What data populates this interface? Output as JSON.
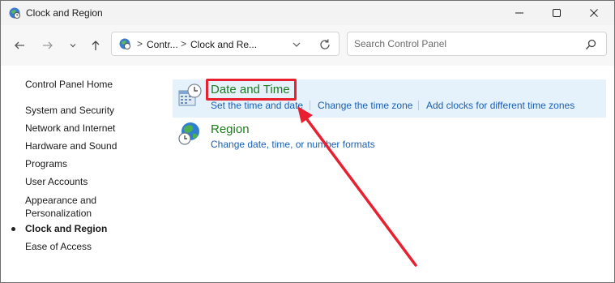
{
  "window": {
    "title": "Clock and Region"
  },
  "title_buttons": {
    "minimize": "—",
    "maximize": "☐",
    "close": "✕"
  },
  "address": {
    "breadcrumbs": [
      "Contr...",
      "Clock and Re..."
    ],
    "separator": ">"
  },
  "search": {
    "placeholder": "Search Control Panel"
  },
  "sidebar": {
    "home": "Control Panel Home",
    "items": [
      {
        "label": "System and Security",
        "active": false
      },
      {
        "label": "Network and Internet",
        "active": false
      },
      {
        "label": "Hardware and Sound",
        "active": false
      },
      {
        "label": "Programs",
        "active": false
      },
      {
        "label": "User Accounts",
        "active": false
      },
      {
        "label": "Appearance and Personalization",
        "active": false
      },
      {
        "label": "Clock and Region",
        "active": true
      },
      {
        "label": "Ease of Access",
        "active": false
      }
    ]
  },
  "categories": [
    {
      "title": "Date and Time",
      "tasks": [
        "Set the time and date",
        "Change the time zone",
        "Add clocks for different time zones"
      ]
    },
    {
      "title": "Region",
      "tasks": [
        "Change date, time, or number formats"
      ]
    }
  ],
  "colors": {
    "highlight": "#e8202f",
    "category_title": "#1e7b1e",
    "link": "#1a5fb4",
    "row_hover": "#e5f1fb"
  }
}
